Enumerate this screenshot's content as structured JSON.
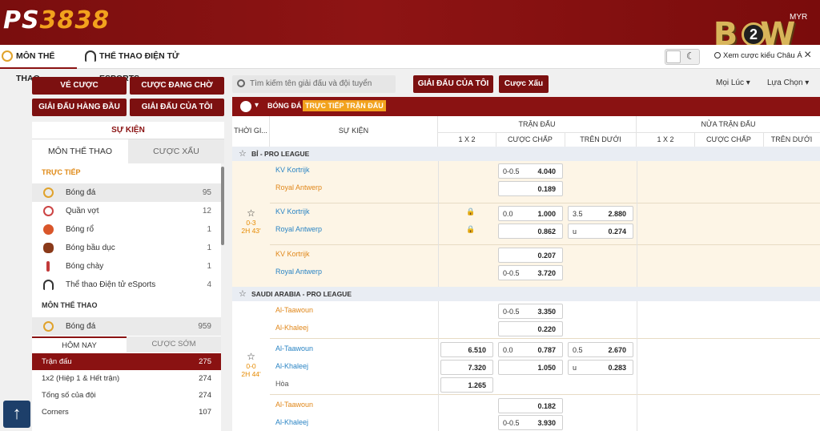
{
  "brand": {
    "logo_a": "PS",
    "logo_b": "3838",
    "partner": "B",
    "partner_num": "2",
    "partner_end": "W",
    "currency": "MYR"
  },
  "nav": {
    "tab_sports": "MÔN THỂ THAO",
    "tab_esports": "THỂ THAO ĐIỆN TỬ ESPORTS",
    "odds_type": "Xem cược kiểu Châu Á",
    "theme_icon": "moon-icon",
    "close": "×"
  },
  "sidebar": {
    "btn_ve_cuoc": "VÉ CƯỢC",
    "btn_cuoc_dang_cho": "CƯỢC ĐANG CHỜ",
    "btn_giai_hang_dau": "GIẢI ĐẤU HÀNG ĐẦU",
    "btn_giai_cua_toi": "GIẢI ĐẤU CỦA TÔI",
    "events": "SỰ KIỆN",
    "tab_sports": "MÔN THỂ THAO",
    "tab_bad": "CƯỢC XẤU",
    "live_label": "TRỰC TIẾP",
    "live_sports": [
      {
        "name": "Bóng đá",
        "count": "95"
      },
      {
        "name": "Quần vợt",
        "count": "12"
      },
      {
        "name": "Bóng rổ",
        "count": "1"
      },
      {
        "name": "Bóng bầu dục",
        "count": "1"
      },
      {
        "name": "Bóng chày",
        "count": "1"
      },
      {
        "name": "Thể thao Điện tử eSports",
        "count": "4"
      }
    ],
    "sports_label": "MÔN THỂ THAO",
    "football": {
      "name": "Bóng đá",
      "count": "959"
    },
    "sub_today": "HÔM NAY",
    "sub_early": "CƯỢC SỚM",
    "bet_types": [
      {
        "name": "Trận đấu",
        "count": "275"
      },
      {
        "name": "1x2 (Hiệp 1 & Hết trận)",
        "count": "274"
      },
      {
        "name": "Tổng số của đội",
        "count": "274"
      },
      {
        "name": "Corners",
        "count": "107"
      }
    ],
    "up_glyph": "↑"
  },
  "toolbar": {
    "search_placeholder": "Tìm kiếm tên giải đấu và đội tuyển",
    "my_league": "GIẢI ĐẤU CỦA TÔI",
    "bad_bet": "Cược Xấu",
    "anytime": "Mọi Lúc ▾",
    "options": "Lựa Chọn ▾"
  },
  "table": {
    "sport": "BÓNG ĐÁ",
    "live": "TRỰC TIẾP TRẬN ĐẤU",
    "h_time": "THỜI GI...",
    "h_event": "SỰ KIỆN",
    "h_match": "TRẬN ĐẤU",
    "h_half": "NỬA TRẬN ĐẤU",
    "h_1x2": "1 X 2",
    "h_hdp": "CƯỢC CHẤP",
    "h_ou": "TRÊN DƯỚI",
    "league1": "BỈ - PRO LEAGUE",
    "m1": {
      "score": "0-3",
      "time": "2H 43'",
      "r1": {
        "home": "KV Kortrijk",
        "away": "Royal Antwerp",
        "hdp_line": "0-0.5",
        "hdp_home": "4.040",
        "hdp_away": "0.189"
      },
      "r2": {
        "home": "KV Kortrijk",
        "away": "Royal Antwerp",
        "hdp_line": "0.0",
        "hdp_home": "1.000",
        "hdp_away": "0.862",
        "ou_line": "3.5",
        "ou_over": "2.880",
        "ou_u": "u",
        "ou_under": "0.274"
      },
      "r3": {
        "home": "KV Kortrijk",
        "away": "Royal Antwerp",
        "hdp_home": "0.207",
        "hdp_line": "0-0.5",
        "hdp_away": "3.720"
      }
    },
    "league2": "SAUDI ARABIA - PRO LEAGUE",
    "m2": {
      "score": "0-0",
      "time": "2H 44'",
      "r1": {
        "home": "Al-Taawoun",
        "away": "Al-Khaleej",
        "hdp_line": "0-0.5",
        "hdp_home": "3.350",
        "hdp_away": "0.220"
      },
      "r2": {
        "home": "Al-Taawoun",
        "away": "Al-Khaleej",
        "draw": "Hòa",
        "x1": "6.510",
        "x2": "7.320",
        "xd": "1.265",
        "hdp_line": "0.0",
        "hdp_home": "0.787",
        "hdp_away": "1.050",
        "ou_line": "0.5",
        "ou_over": "2.670",
        "ou_u": "u",
        "ou_under": "0.283"
      },
      "r3": {
        "home": "Al-Taawoun",
        "away": "Al-Khaleej",
        "hdp_home": "0.182",
        "hdp_line": "0-0.5",
        "hdp_away": "3.930"
      }
    }
  },
  "colors": {
    "brand_red": "#8a1212",
    "accent_orange": "#f2a21d",
    "team_blue": "#2a84c4",
    "team_orange": "#e0871a"
  }
}
